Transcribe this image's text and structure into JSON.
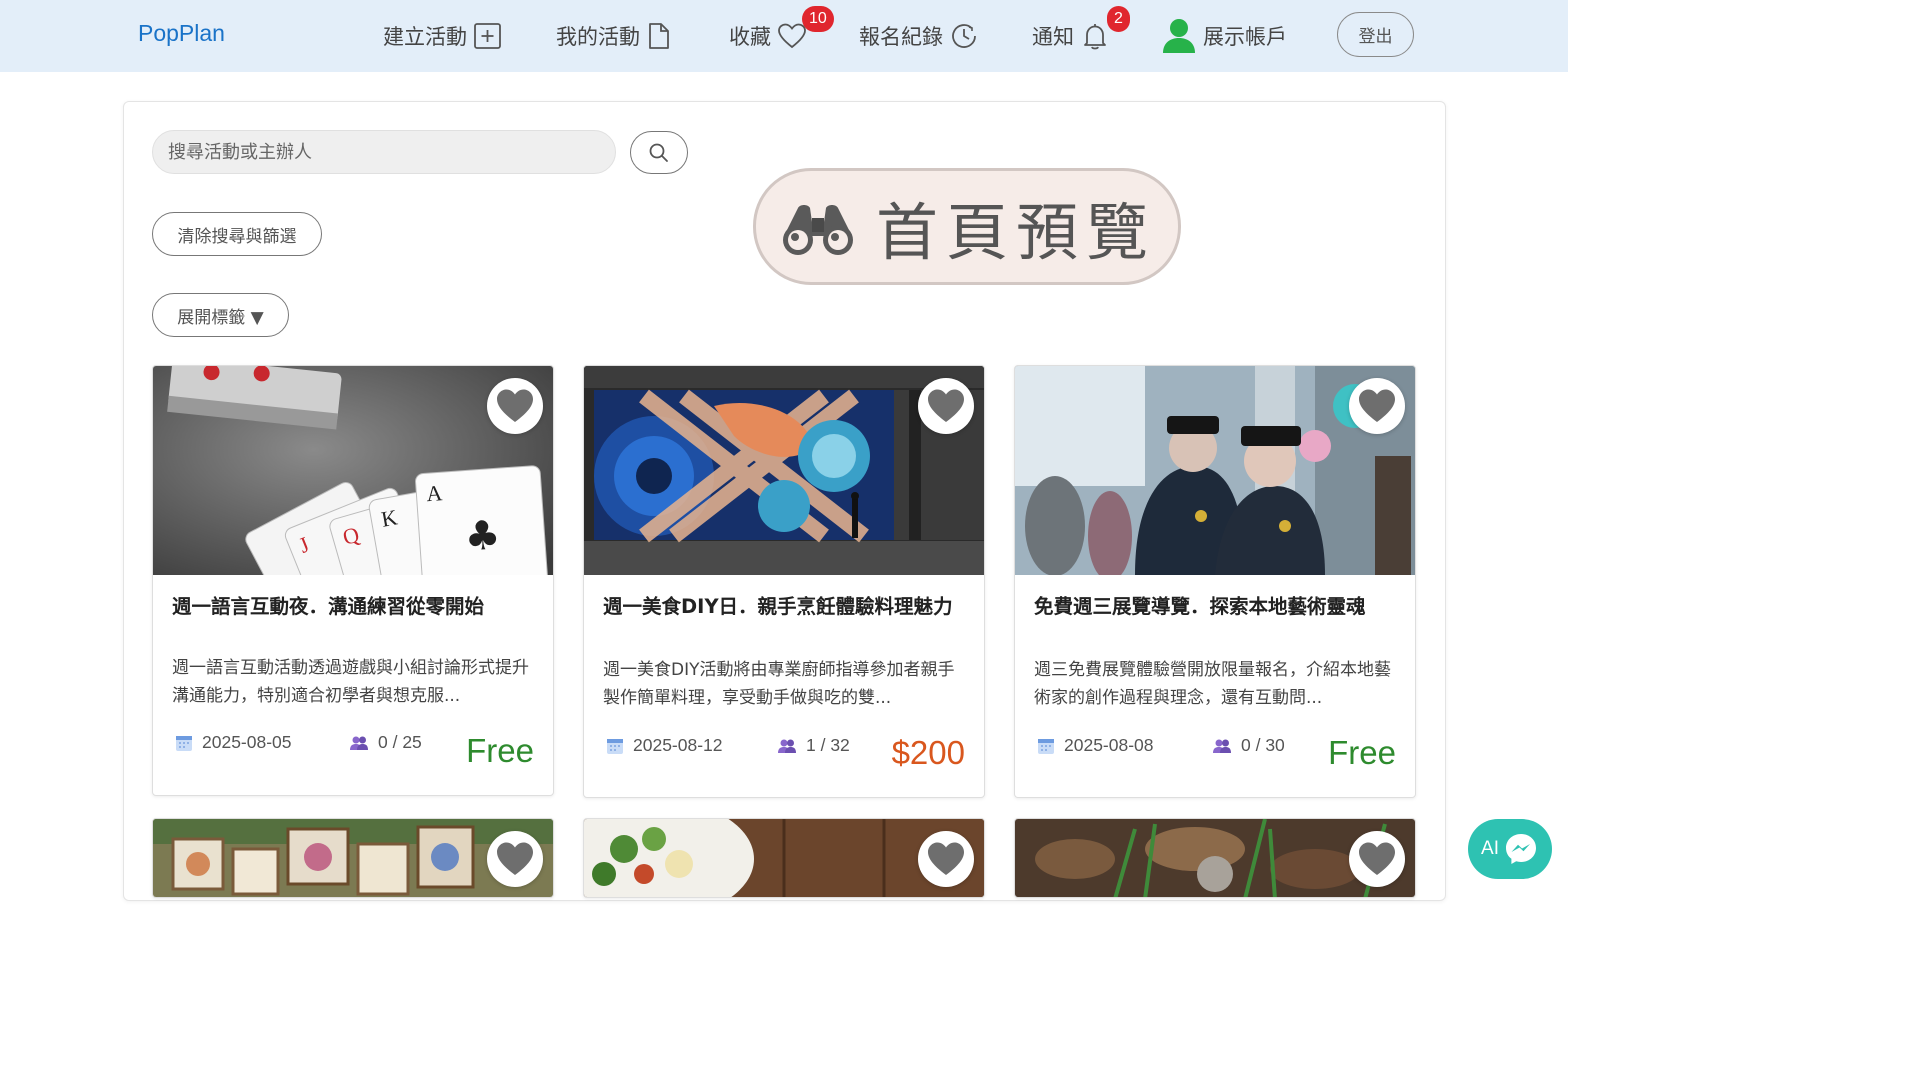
{
  "header": {
    "brand": "PopPlan",
    "nav": {
      "create": "建立活動",
      "mine": "我的活動",
      "favorites": "收藏",
      "favorites_count": "10",
      "records": "報名紀錄",
      "notifications": "通知",
      "notifications_count": "2",
      "account": "展示帳戶",
      "logout": "登出"
    }
  },
  "search": {
    "placeholder": "搜尋活動或主辦人",
    "clear_label": "清除搜尋與篩選",
    "tags_label": "展開標籤 ▼"
  },
  "preview_label": "首頁預覽",
  "colors": {
    "accent": "#1a73c8",
    "free": "#2e8b2e",
    "paid": "#d9571e",
    "badge": "#e0262e",
    "ai": "#2ec2b2"
  },
  "cards": [
    {
      "title": "週一語言互動夜．溝通練習從零開始",
      "desc": "週一語言互動活動透過遊戲與小組討論形式提升溝通能力，特別適合初學者與想克服...",
      "date": "2025-08-05",
      "capacity": "0 / 25",
      "price": "Free"
    },
    {
      "title": "週一美食DIY日．親手烹飪體驗料理魅力",
      "desc": "週一美食DIY活動將由專業廚師指導參加者親手製作簡單料理，享受動手做與吃的雙...",
      "date": "2025-08-12",
      "capacity": "1 / 32",
      "price": "$200"
    },
    {
      "title": "免費週三展覽導覽．探索本地藝術靈魂",
      "desc": "週三免費展覽體驗營開放限量報名，介紹本地藝術家的創作過程與理念，還有互動問...",
      "date": "2025-08-08",
      "capacity": "0 / 30",
      "price": "Free"
    }
  ],
  "ai_chat_label": "AI"
}
